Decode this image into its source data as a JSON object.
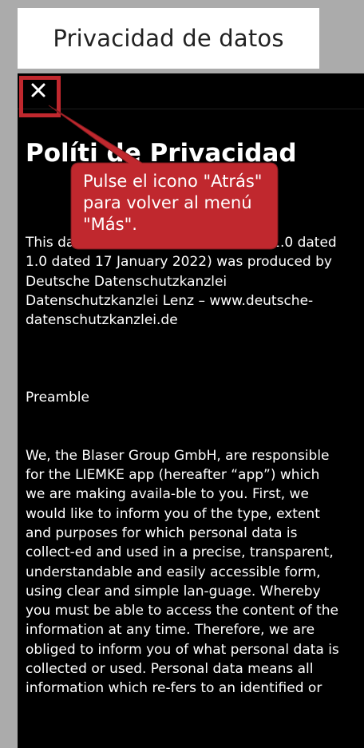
{
  "caption": {
    "title": "Privacidad de datos"
  },
  "app": {
    "close_icon": "close-icon",
    "policy_title": "Políti  de Privacidad",
    "body_lines_1": [
      "This data protection notice (version 1.0 dated",
      "1.0 dated 17 January 2022) was produced by",
      "Deutsche Datenschutzkanzlei",
      "Datenschutzkanzlei Lenz – www.deutsche-",
      "datenschutzkanzlei.de"
    ],
    "preamble_heading": "Preamble",
    "body_lines_2": [
      "We, the Blaser Group GmbH, are responsible",
      "for the LIEMKE app (hereafter “app”) which",
      "we are making availa-ble to you. First, we",
      "would like to inform you of the type, extent",
      "and purposes for which personal data is",
      "collect-ed and used in a precise, transparent,",
      "understandable and easily accessible form,",
      "using clear and simple lan-guage. Whereby",
      "you must be able to access the content of the",
      "information at any time. Therefore, we are",
      "obliged to inform you of what personal data is",
      "collected or used. Personal data means all",
      "information which re-fers to an identified or"
    ]
  },
  "callout": {
    "lines": [
      "Pulse el icono \"Atrás\"",
      "para volver al menú",
      "\"Más\"."
    ],
    "color": "#c0282e"
  },
  "colors": {
    "page_background": "#ababab",
    "screen_background": "#000000",
    "text": "#ffffff",
    "highlight": "#c0282e"
  }
}
